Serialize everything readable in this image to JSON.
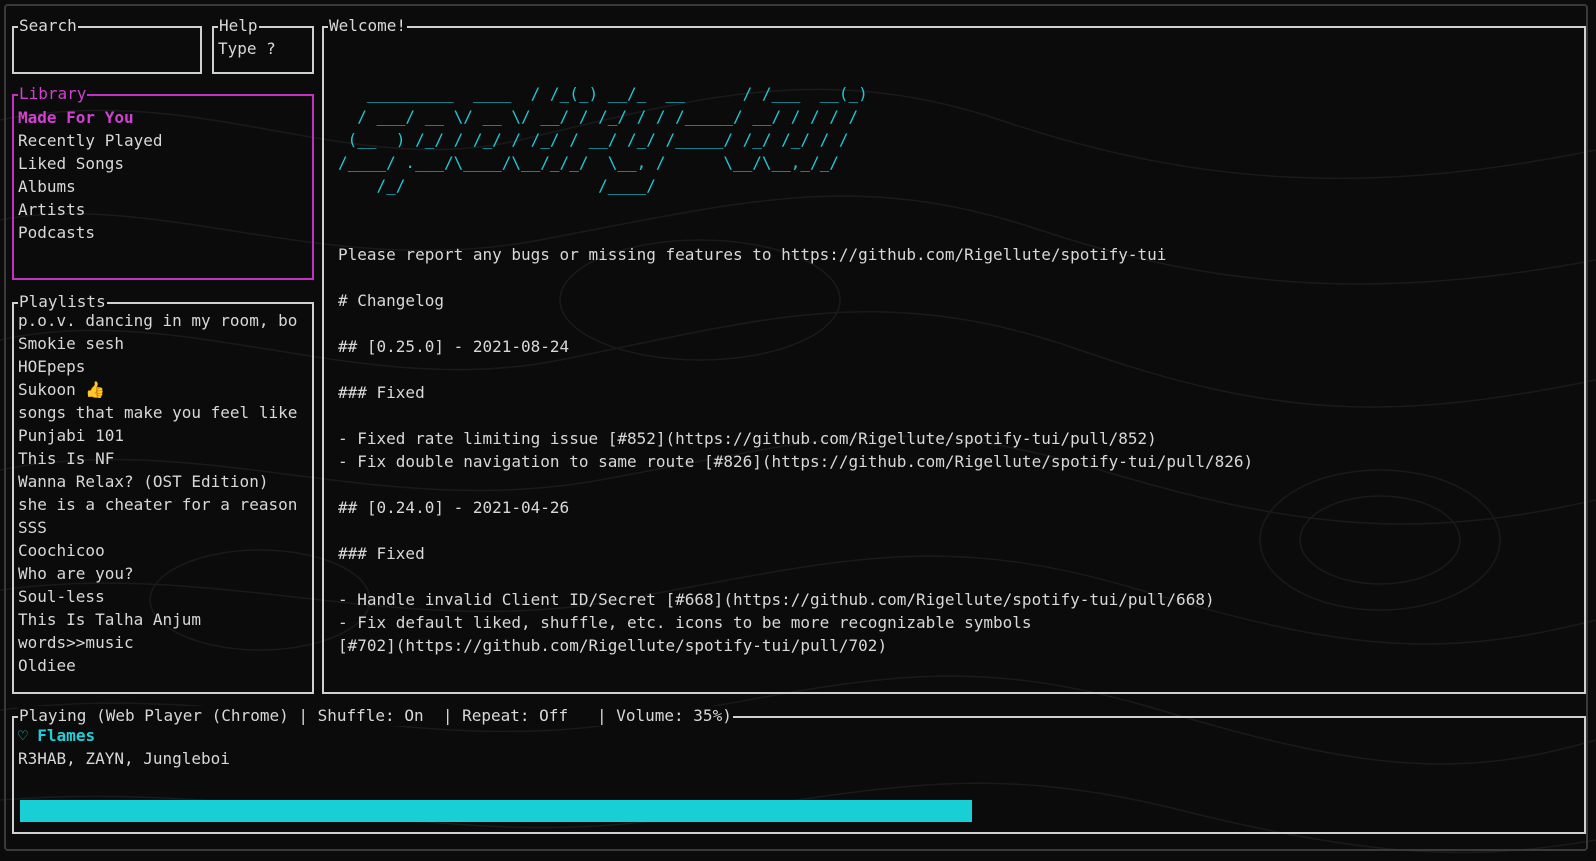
{
  "search": {
    "title": "Search",
    "value": "",
    "placeholder": ""
  },
  "help": {
    "title": "Help",
    "text": "Type ?"
  },
  "library": {
    "title": "Library",
    "items": [
      {
        "label": "Made For You"
      },
      {
        "label": "Recently Played"
      },
      {
        "label": "Liked Songs"
      },
      {
        "label": "Albums"
      },
      {
        "label": "Artists"
      },
      {
        "label": "Podcasts"
      }
    ]
  },
  "playlists": {
    "title": "Playlists",
    "items": [
      {
        "label": "p.o.v. dancing in my room, bo"
      },
      {
        "label": "Smokie sesh"
      },
      {
        "label": "HOEpeps"
      },
      {
        "label": "Sukoon 👍"
      },
      {
        "label": "songs that make you feel like"
      },
      {
        "label": "Punjabi 101"
      },
      {
        "label": "This Is NF"
      },
      {
        "label": "Wanna Relax? (OST Edition)"
      },
      {
        "label": "she is a cheater for a reason"
      },
      {
        "label": "SSS"
      },
      {
        "label": "Coochicoo"
      },
      {
        "label": "Who are you?"
      },
      {
        "label": "Soul-less"
      },
      {
        "label": "This Is Talha Anjum"
      },
      {
        "label": "words>>music"
      },
      {
        "label": "Oldiee"
      }
    ]
  },
  "welcome": {
    "title": "Welcome!",
    "ascii": [
      "   _________  ____  / /_(_) __/_  __      / /___  __(_)",
      "  / ___/ __ \\/ __ \\/ __/ / /_/ / / /_____/ __/ / / / /",
      " (__  ) /_/ / /_/ / /_/ / __/ /_/ /_____/ /_/ /_/ / /",
      "/____/ .___/\\____/\\__/_/_/  \\__, /      \\__/\\__,_/_/",
      "    /_/                    /____/"
    ],
    "lines": [
      "",
      "",
      "Please report any bugs or missing features to https://github.com/Rigellute/spotify-tui",
      "",
      "# Changelog",
      "",
      "## [0.25.0] - 2021-08-24",
      "",
      "### Fixed",
      "",
      "- Fixed rate limiting issue [#852](https://github.com/Rigellute/spotify-tui/pull/852)",
      "- Fix double navigation to same route [#826](https://github.com/Rigellute/spotify-tui/pull/826)",
      "",
      "## [0.24.0] - 2021-04-26",
      "",
      "### Fixed",
      "",
      "- Handle invalid Client ID/Secret [#668](https://github.com/Rigellute/spotify-tui/pull/668)",
      "- Fix default liked, shuffle, etc. icons to be more recognizable symbols",
      "[#702](https://github.com/Rigellute/spotify-tui/pull/702)"
    ]
  },
  "playing": {
    "title": "Playing (Web Player (Chrome) | Shuffle: On  | Repeat: Off   | Volume: 35%)",
    "heart_icon": "♡",
    "track": "Flames",
    "artists": "R3HAB, ZAYN, Jungleboi",
    "progress": 0.6
  },
  "colors": {
    "accent_cyan": "#1fc8d8",
    "library_magenta": "#c42fc4",
    "border": "#d0d0d0",
    "background": "#0b0b0b"
  }
}
